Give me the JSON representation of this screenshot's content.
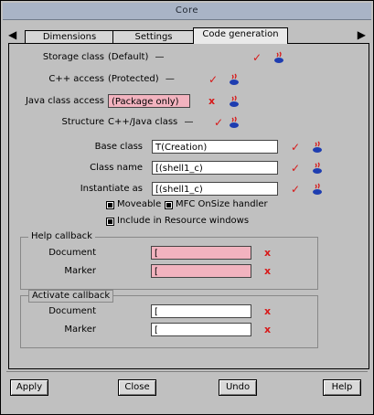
{
  "window": {
    "title": "Core"
  },
  "tabs": [
    {
      "label": "Dimensions",
      "active": false
    },
    {
      "label": "Settings",
      "active": false
    },
    {
      "label": "Code generation",
      "active": true
    }
  ],
  "nav": {
    "left_arrow": "◀",
    "right_arrow": "▶"
  },
  "form": {
    "storage_class": {
      "label": "Storage class",
      "value": "(Default)",
      "status": "ok"
    },
    "cpp_access": {
      "label": "C++ access",
      "value": "(Protected)",
      "status": "ok"
    },
    "java_class_access": {
      "label": "Java class access",
      "value": "(Package only)",
      "status": "error"
    },
    "structure": {
      "label": "Structure",
      "value": "C++/Java class",
      "status": "ok"
    },
    "base_class": {
      "label": "Base class",
      "value": "T(Creation)",
      "status": "ok"
    },
    "class_name": {
      "label": "Class name",
      "value": "[(shell1_c)",
      "status": "ok"
    },
    "instantiate_as": {
      "label": "Instantiate as",
      "value": "[(shell1_c)",
      "status": "ok"
    }
  },
  "checkboxes": [
    {
      "label": "Moveable",
      "checked": true
    },
    {
      "label": "MFC OnSize handler",
      "checked": true
    },
    {
      "label": "Include in Resource windows",
      "checked": true
    }
  ],
  "help_callback": {
    "title": "Help callback",
    "document": {
      "label": "Document",
      "value": "[",
      "status": "error"
    },
    "marker": {
      "label": "Marker",
      "value": "[",
      "status": "error"
    }
  },
  "activate_callback": {
    "title": "Activate callback",
    "document": {
      "label": "Document",
      "value": "[",
      "status": "error"
    },
    "marker": {
      "label": "Marker",
      "value": "[",
      "status": "error"
    }
  },
  "buttons": {
    "apply": "Apply",
    "close": "Close",
    "undo": "Undo",
    "help": "Help"
  },
  "glyphs": {
    "check": "✓",
    "cross": "x",
    "dropdown": "—"
  },
  "colors": {
    "error_field": "#f2b3bf",
    "mark_red": "#d71919",
    "titlebar": "#a9b4c6"
  }
}
